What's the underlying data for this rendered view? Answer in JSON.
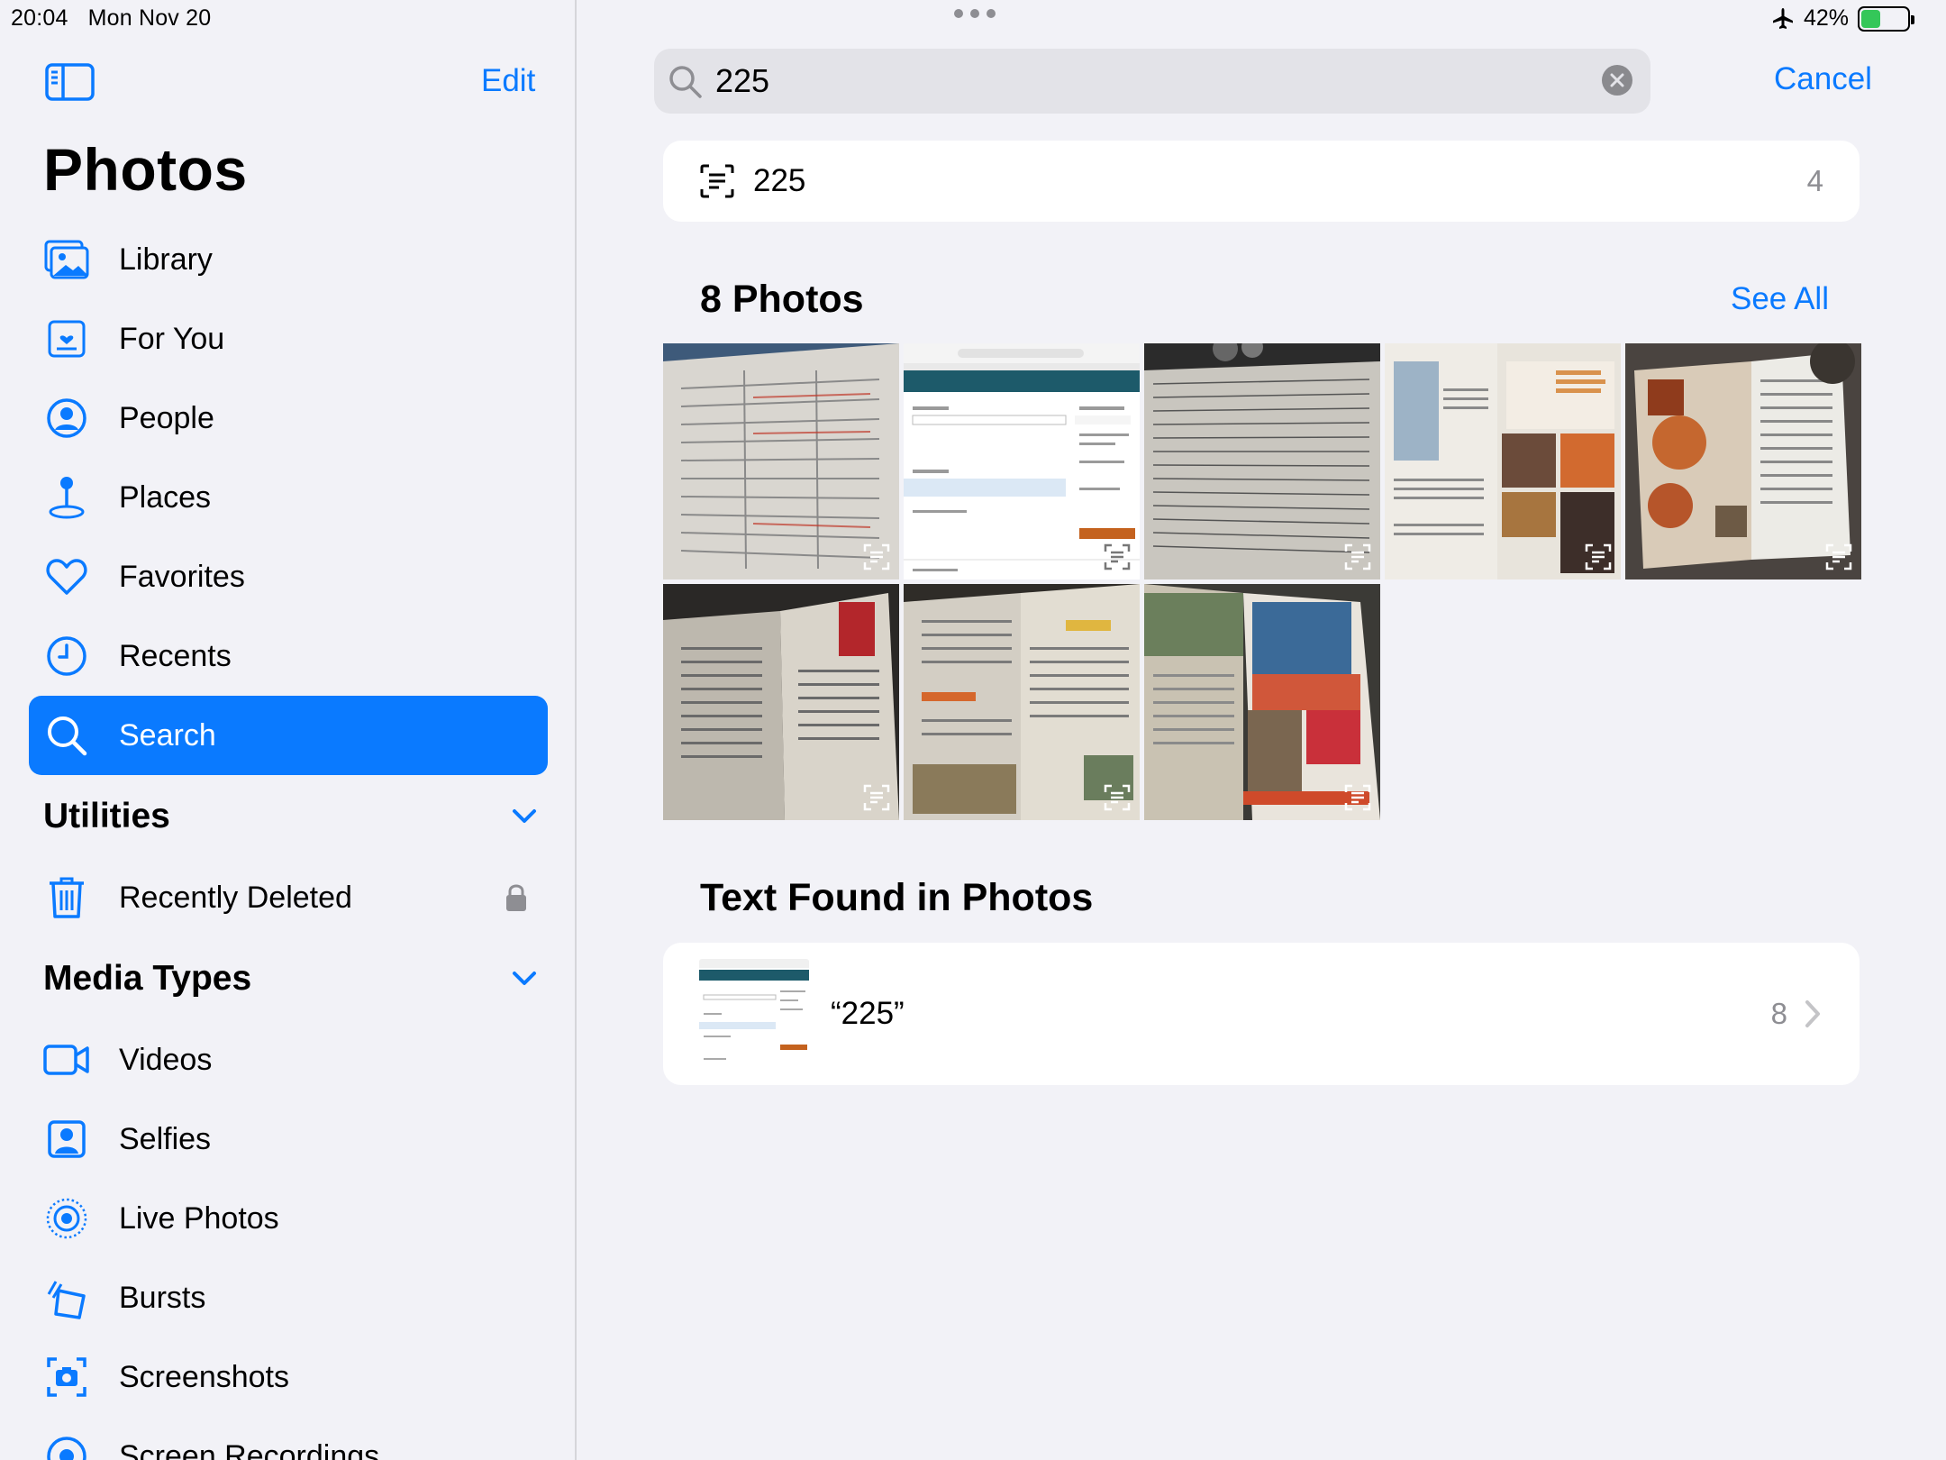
{
  "status": {
    "time": "20:04",
    "date": "Mon Nov 20",
    "battery": "42%",
    "battery_level": 0.42
  },
  "sidebar": {
    "edit_label": "Edit",
    "title": "Photos",
    "items": [
      {
        "label": "Library",
        "icon": "library-icon"
      },
      {
        "label": "For You",
        "icon": "for-you-icon"
      },
      {
        "label": "People",
        "icon": "people-icon"
      },
      {
        "label": "Places",
        "icon": "places-icon"
      },
      {
        "label": "Favorites",
        "icon": "heart-icon"
      },
      {
        "label": "Recents",
        "icon": "clock-icon"
      },
      {
        "label": "Search",
        "icon": "search-icon",
        "selected": true
      }
    ],
    "utilities": {
      "title": "Utilities",
      "items": [
        {
          "label": "Recently Deleted",
          "icon": "trash-icon",
          "locked": true
        }
      ]
    },
    "media_types": {
      "title": "Media Types",
      "items": [
        {
          "label": "Videos",
          "icon": "video-icon"
        },
        {
          "label": "Selfies",
          "icon": "selfie-icon"
        },
        {
          "label": "Live Photos",
          "icon": "live-photo-icon"
        },
        {
          "label": "Bursts",
          "icon": "bursts-icon"
        },
        {
          "label": "Screenshots",
          "icon": "screenshot-icon"
        },
        {
          "label": "Screen Recordings",
          "icon": "screen-recording-icon"
        }
      ]
    }
  },
  "search": {
    "query": "225",
    "cancel_label": "Cancel"
  },
  "suggestion": {
    "text": "225",
    "count": "4"
  },
  "photos_section": {
    "title": "8 Photos",
    "see_all": "See All",
    "count": 8
  },
  "text_found": {
    "title": "Text Found in Photos",
    "label": "“225”",
    "count": "8"
  },
  "colors": {
    "accent": "#0a7aff",
    "background": "#f2f2f7"
  }
}
